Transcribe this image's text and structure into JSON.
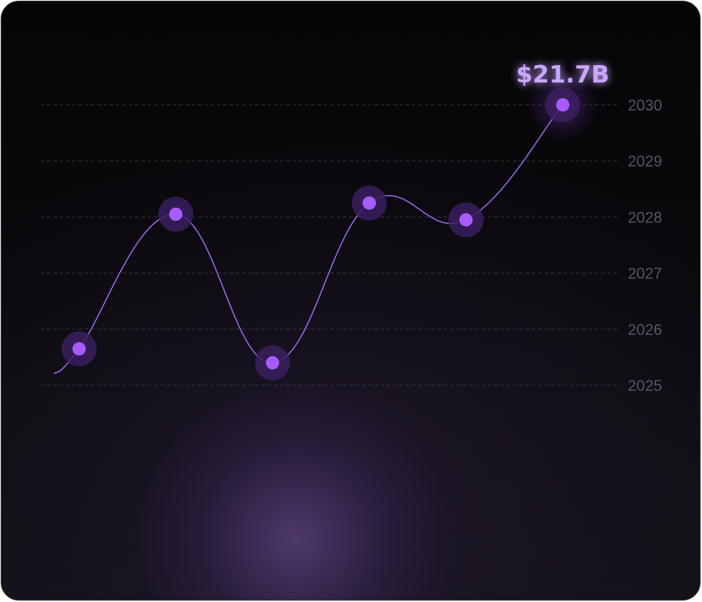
{
  "chart_data": {
    "type": "line",
    "title": "",
    "xlabel": "",
    "ylabel": "",
    "y_axis_position": "right",
    "y_tick_labels": [
      "2025",
      "2026",
      "2027",
      "2028",
      "2029",
      "2030"
    ],
    "ylim": [
      2025,
      2030
    ],
    "grid": true,
    "grid_style": "dashed",
    "smooth": true,
    "x": [
      1,
      2,
      3,
      4,
      5,
      6
    ],
    "y": [
      2025.65,
      2028.05,
      2025.4,
      2028.25,
      2027.95,
      2030.0
    ],
    "annotation": {
      "text": "$21.7B",
      "point_index": 5
    },
    "colors": {
      "line": "#a06cf2",
      "marker": "#a85cff",
      "halo": "#3a1f5e",
      "grid": "#3c3744",
      "tick_label": "#5a5266",
      "annotation": "#c9a6ff"
    }
  }
}
